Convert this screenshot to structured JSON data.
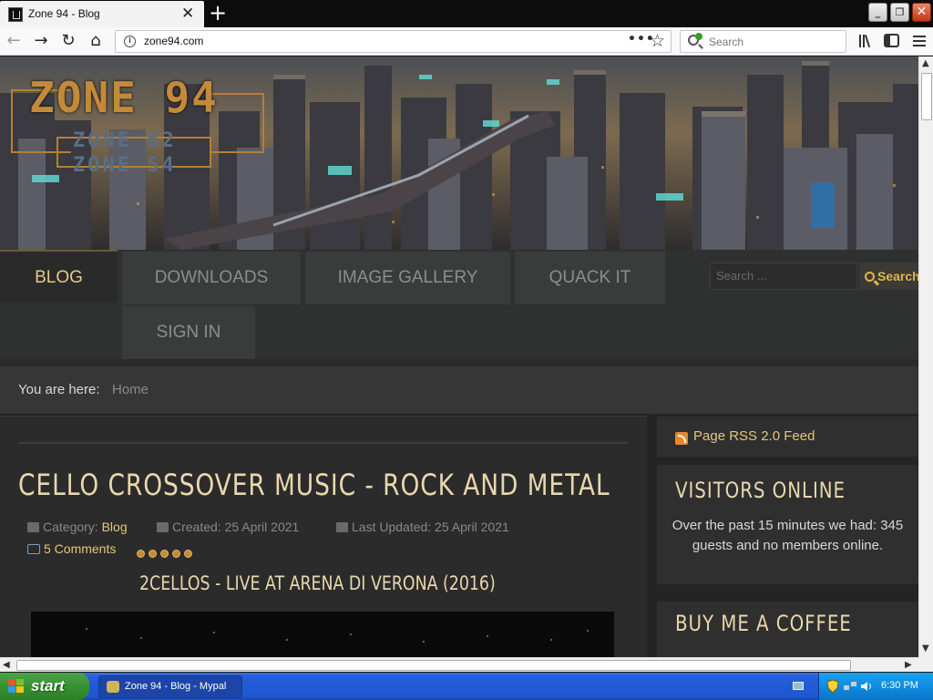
{
  "browser": {
    "tab_title": "Zone 94 - Blog",
    "tab_close": "✕",
    "new_tab": "+",
    "url": "zone94.com",
    "url_more": "•••",
    "search_placeholder": "Search",
    "window_buttons": {
      "minimize": "_",
      "restore": "❐",
      "close": "✕"
    }
  },
  "site": {
    "logo_main": "ZONE 94",
    "logo_sub1": "ZONE 62",
    "logo_sub2": "ZONE 54",
    "menu": [
      "BLOG",
      "DOWNLOADS",
      "IMAGE GALLERY",
      "QUACK IT",
      "SIGN IN"
    ],
    "active_menu": "BLOG",
    "search_placeholder": "Search ...",
    "search_button": "Search",
    "breadcrumb_label": "You are here:",
    "breadcrumb_home": "Home"
  },
  "article": {
    "title": "CELLO CROSSOVER MUSIC - ROCK AND METAL",
    "category_label": "Category:",
    "category": "Blog",
    "created": "Created: 25 April 2021",
    "updated": "Last Updated: 25 April 2021",
    "comments": "5 Comments",
    "rating": 5,
    "video_title": "2CELLOS - LIVE AT ARENA DI VERONA (2016)"
  },
  "sidebar": {
    "rss": "Page RSS 2.0 Feed",
    "visitors_heading": "VISITORS ONLINE",
    "visitors_text": "Over the past 15 minutes we had: 345 guests and no members online.",
    "coffee_heading": "BUY ME A COFFEE"
  },
  "taskbar": {
    "start": "start",
    "task": "Zone 94 - Blog - Mypal",
    "clock": "6:30 PM"
  },
  "colors": {
    "accent_gold": "#e3c77a",
    "title_cream": "#e9d7ad",
    "xp_blue": "#245edb",
    "xp_green": "#36922f"
  }
}
